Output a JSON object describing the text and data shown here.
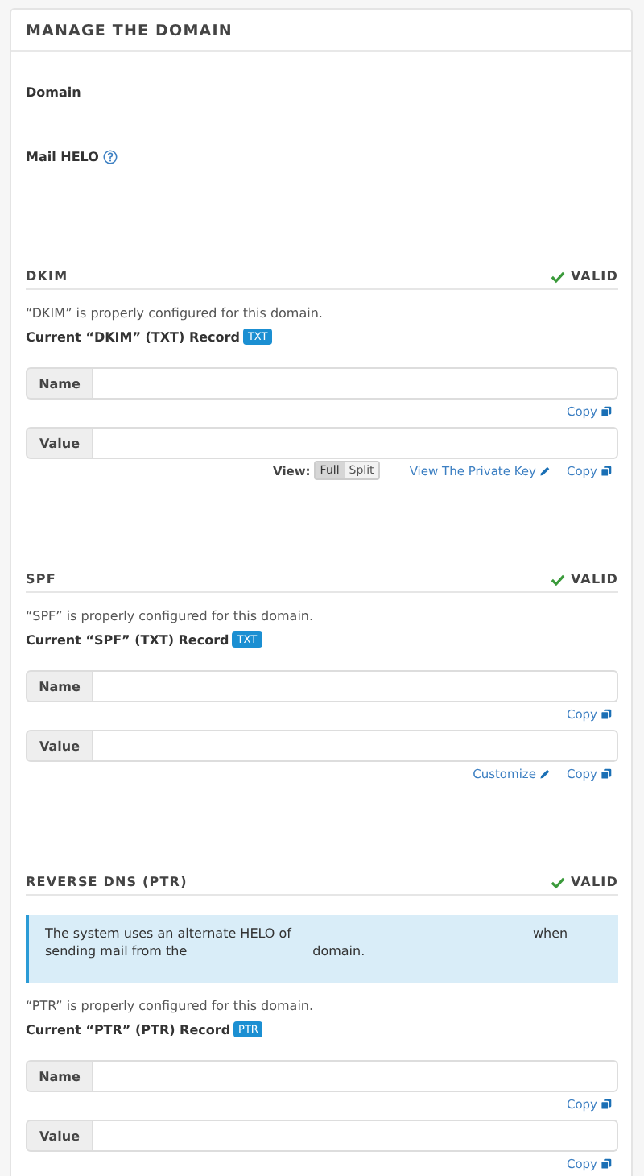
{
  "panel": {
    "title": "MANAGE THE DOMAIN"
  },
  "fields": [
    {
      "label": "Domain"
    },
    {
      "label": "Mail HELO",
      "help": true
    }
  ],
  "sections": [
    {
      "title": "DKIM",
      "status": "VALID",
      "valid": true,
      "message": "“DKIM” is properly configured for this domain.",
      "record_label": "Current “DKIM” (TXT) Record",
      "badge": "TXT",
      "rows": [
        {
          "label": "Name",
          "actions": [
            {
              "kind": "copy",
              "text": "Copy"
            }
          ]
        },
        {
          "label": "Value",
          "view": {
            "label": "View:",
            "options": [
              {
                "text": "Full",
                "selected": true
              },
              {
                "text": "Split",
                "selected": false
              }
            ]
          },
          "actions": [
            {
              "kind": "edit",
              "text": "View The Private Key"
            },
            {
              "kind": "copy",
              "text": "Copy"
            }
          ]
        }
      ]
    },
    {
      "title": "SPF",
      "status": "VALID",
      "valid": true,
      "message": "“SPF” is properly configured for this domain.",
      "record_label": "Current “SPF” (TXT) Record",
      "badge": "TXT",
      "rows": [
        {
          "label": "Name",
          "actions": [
            {
              "kind": "copy",
              "text": "Copy"
            }
          ]
        },
        {
          "label": "Value",
          "actions": [
            {
              "kind": "edit",
              "text": "Customize"
            },
            {
              "kind": "copy",
              "text": "Copy"
            }
          ]
        }
      ]
    },
    {
      "title": "REVERSE DNS (PTR)",
      "status": "VALID",
      "valid": true,
      "alert": [
        "The system uses an alternate HELO of",
        "when sending mail from the",
        "domain."
      ],
      "message": "“PTR” is properly configured for this domain.",
      "record_label": "Current “PTR” (PTR) Record",
      "badge": "PTR",
      "rows": [
        {
          "label": "Name",
          "actions": [
            {
              "kind": "copy",
              "text": "Copy"
            }
          ]
        },
        {
          "label": "Value",
          "actions": [
            {
              "kind": "copy",
              "text": "Copy"
            }
          ]
        }
      ]
    }
  ]
}
